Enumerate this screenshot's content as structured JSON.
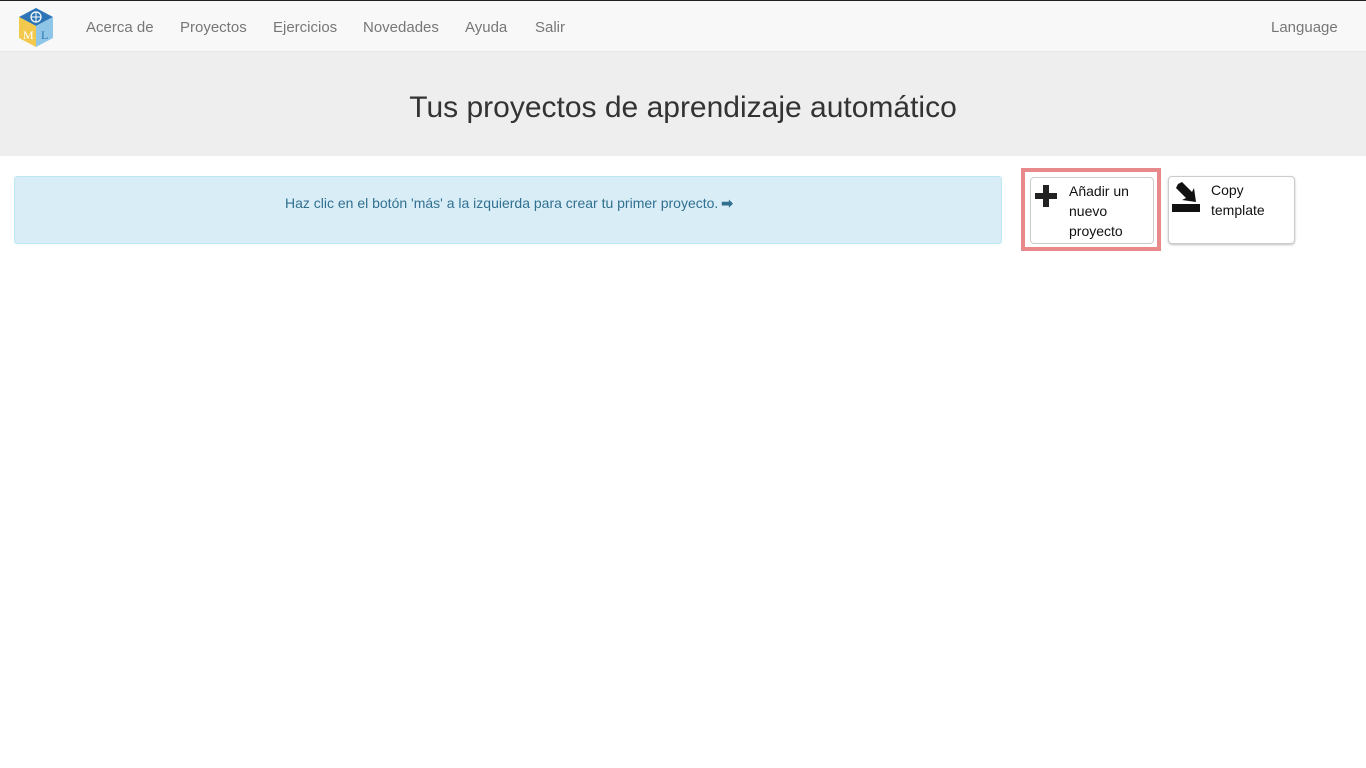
{
  "navbar": {
    "logo_letters": [
      "M",
      "L"
    ],
    "links": [
      "Acerca de",
      "Proyectos",
      "Ejercicios",
      "Novedades",
      "Ayuda",
      "Salir"
    ],
    "language": "Language"
  },
  "header": {
    "title": "Tus proyectos de aprendizaje automático"
  },
  "alert": {
    "message": "Haz clic en el botón 'más' a la izquierda para crear tu primer proyecto.",
    "icon": "arrow-right-icon"
  },
  "actions": {
    "add_project_label": "Añadir un nuevo proyecto",
    "add_project_icon": "plus-icon",
    "copy_template_label": "Copy template",
    "copy_template_icon": "import-icon"
  },
  "colors": {
    "alert_bg": "#d9edf7",
    "alert_text": "#31708f",
    "highlight": "#e8898b"
  }
}
